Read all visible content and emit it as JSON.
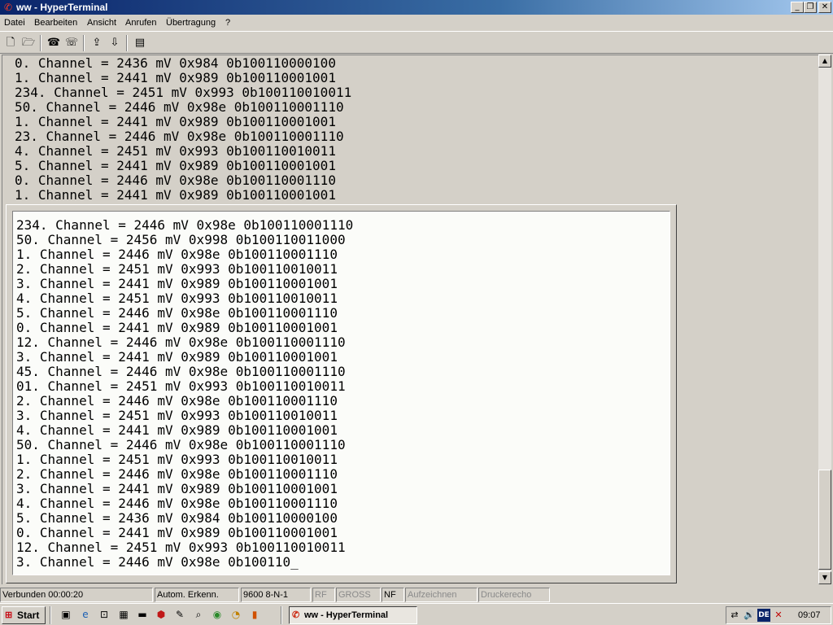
{
  "window": {
    "title": "ww - HyperTerminal"
  },
  "menu": [
    "Datei",
    "Bearbeiten",
    "Ansicht",
    "Anrufen",
    "Übertragung",
    "?"
  ],
  "toolbar": {
    "icons": [
      "new-icon",
      "open-icon",
      "call-icon",
      "disconnect-icon",
      "send-icon",
      "receive-icon",
      "properties-icon"
    ]
  },
  "terminal": {
    "background_lines": [
      "0. Channel = 2436 mV 0x984 0b100110000100",
      "1. Channel = 2441 mV 0x989 0b100110001001",
      "234. Channel = 2451 mV 0x993 0b100110010011",
      "50. Channel = 2446 mV 0x98e 0b100110001110",
      "1. Channel = 2441 mV 0x989 0b100110001001",
      "23. Channel = 2446 mV 0x98e 0b100110001110",
      "4. Channel = 2451 mV 0x993 0b100110010011",
      "5. Channel = 2441 mV 0x989 0b100110001001",
      "0. Channel = 2446 mV 0x98e 0b100110001110",
      "1. Channel = 2441 mV 0x989 0b100110001001"
    ],
    "lines": [
      "234. Channel = 2446 mV 0x98e 0b100110001110",
      "50. Channel = 2456 mV 0x998 0b100110011000",
      "1. Channel = 2446 mV 0x98e 0b100110001110",
      "2. Channel = 2451 mV 0x993 0b100110010011",
      "3. Channel = 2441 mV 0x989 0b100110001001",
      "4. Channel = 2451 mV 0x993 0b100110010011",
      "5. Channel = 2446 mV 0x98e 0b100110001110",
      "0. Channel = 2441 mV 0x989 0b100110001001",
      "12. Channel = 2446 mV 0x98e 0b100110001110",
      "3. Channel = 2441 mV 0x989 0b100110001001",
      "45. Channel = 2446 mV 0x98e 0b100110001110",
      "01. Channel = 2451 mV 0x993 0b100110010011",
      "2. Channel = 2446 mV 0x98e 0b100110001110",
      "3. Channel = 2451 mV 0x993 0b100110010011",
      "4. Channel = 2441 mV 0x989 0b100110001001",
      "50. Channel = 2446 mV 0x98e 0b100110001110",
      "1. Channel = 2451 mV 0x993 0b100110010011",
      "2. Channel = 2446 mV 0x98e 0b100110001110",
      "3. Channel = 2441 mV 0x989 0b100110001001",
      "4. Channel = 2446 mV 0x98e 0b100110001110",
      "5. Channel = 2436 mV 0x984 0b100110000100",
      "0. Channel = 2441 mV 0x989 0b100110001001",
      "12. Channel = 2451 mV 0x993 0b100110010011",
      "3. Channel = 2446 mV 0x98e 0b100110_"
    ]
  },
  "statusbar": {
    "connected": "Verbunden 00:00:20",
    "detect": "Autom. Erkenn.",
    "settings": "9600 8-N-1",
    "rf": "RF",
    "caps": "GROSS",
    "nf": "NF",
    "record": "Aufzeichnen",
    "echo": "Druckerecho"
  },
  "taskbar": {
    "start": "Start",
    "task": "ww - HyperTerminal",
    "lang": "DE",
    "clock": "09:07"
  }
}
